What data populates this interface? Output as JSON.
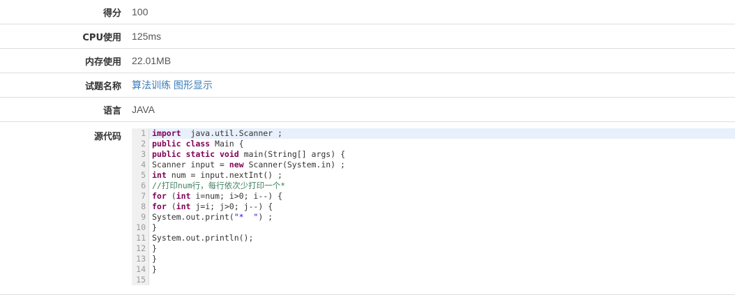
{
  "fields": [
    {
      "label": "得分",
      "value": "100"
    },
    {
      "label": "CPU使用",
      "value": "125ms"
    },
    {
      "label": "内存使用",
      "value": "22.01MB"
    },
    {
      "label": "试题名称",
      "link1": "算法训练",
      "link2": "图形显示"
    },
    {
      "label": "语言",
      "value": "JAVA"
    }
  ],
  "source": {
    "label": "源代码",
    "line_numbers": [
      "1",
      "2",
      "3",
      "4",
      "5",
      "6",
      "7",
      "8",
      "9",
      "10",
      "11",
      "12",
      "13",
      "14",
      "15"
    ],
    "lines": [
      [
        [
          "kw",
          "import"
        ],
        [
          "",
          "  java.util.Scanner ;"
        ]
      ],
      [
        [
          "kw",
          "public"
        ],
        [
          "",
          " "
        ],
        [
          "kw",
          "class"
        ],
        [
          "",
          " Main {"
        ]
      ],
      [
        [
          "kw",
          "public"
        ],
        [
          "",
          " "
        ],
        [
          "kw",
          "static"
        ],
        [
          "",
          " "
        ],
        [
          "kw",
          "void"
        ],
        [
          "",
          " main(String[] args) {"
        ]
      ],
      [
        [
          "",
          "Scanner input = "
        ],
        [
          "kw",
          "new"
        ],
        [
          "",
          " Scanner(System.in) ;"
        ]
      ],
      [
        [
          "kw",
          "int"
        ],
        [
          "",
          " num = input.nextInt() ;"
        ]
      ],
      [
        [
          "cm",
          "//打印num行，每行依次少打印一个*"
        ]
      ],
      [
        [
          "kw",
          "for"
        ],
        [
          "",
          " ("
        ],
        [
          "kw",
          "int"
        ],
        [
          "",
          " i=num; i>0; i--) {"
        ]
      ],
      [
        [
          "kw",
          "for"
        ],
        [
          "",
          " ("
        ],
        [
          "kw",
          "int"
        ],
        [
          "",
          " j=i; j>0; j--) {"
        ]
      ],
      [
        [
          "",
          "System.out.print("
        ],
        [
          "str",
          "\"*  \""
        ],
        [
          "",
          ") ;"
        ]
      ],
      [
        [
          "",
          "}"
        ]
      ],
      [
        [
          "",
          "System.out.println();"
        ]
      ],
      [
        [
          "",
          "}"
        ]
      ],
      [
        [
          "",
          "}"
        ]
      ],
      [
        [
          "",
          "}"
        ]
      ],
      [
        [
          "",
          ""
        ]
      ]
    ]
  },
  "colors": {
    "link": "#3a7bb8",
    "keyword": "#7f0055",
    "comment": "#3f7f5f",
    "string": "#2a00ff",
    "active_line": "#e8f0fb"
  }
}
